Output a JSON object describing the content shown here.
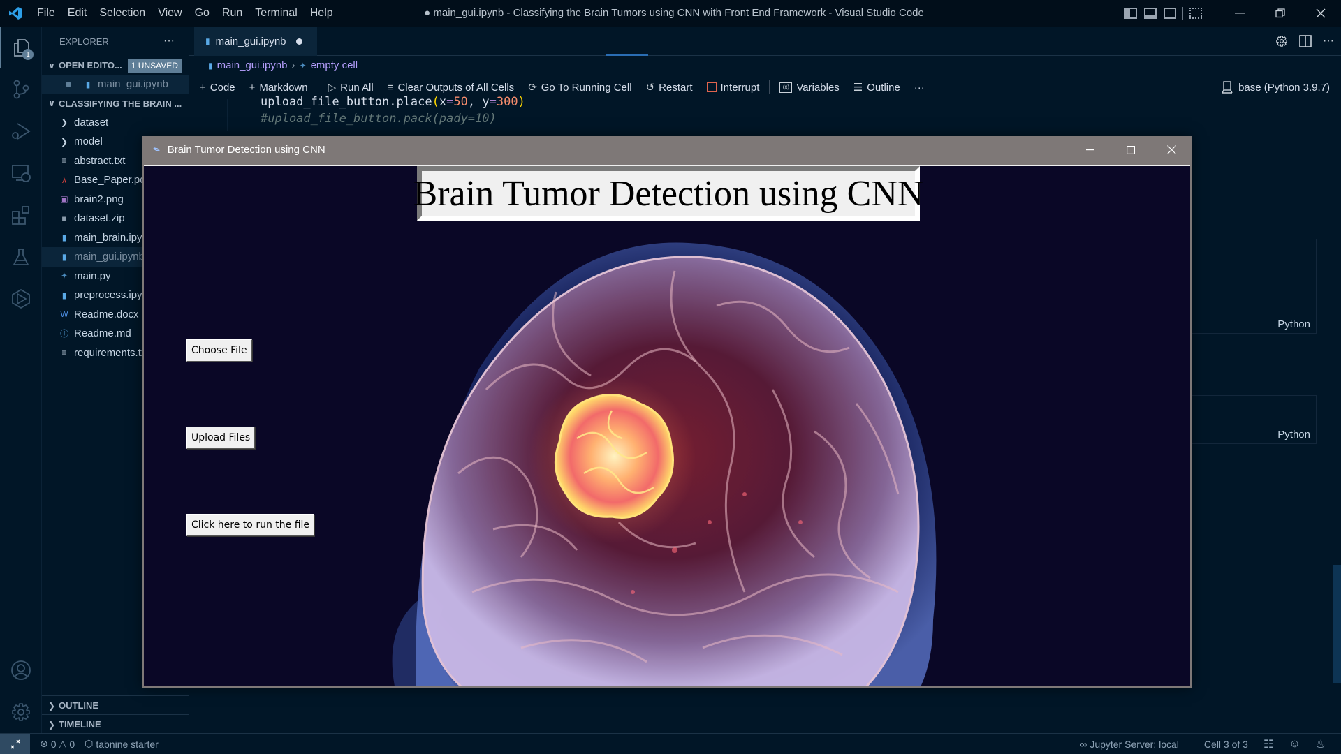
{
  "window": {
    "title": "● main_gui.ipynb - Classifying the Brain Tumors using CNN with Front End Framework - Visual Studio Code",
    "menu": [
      "File",
      "Edit",
      "Selection",
      "View",
      "Go",
      "Run",
      "Terminal",
      "Help"
    ]
  },
  "activity_bar": {
    "items": [
      {
        "name": "explorer",
        "badge": "1"
      },
      {
        "name": "source-control"
      },
      {
        "name": "run-debug"
      },
      {
        "name": "remote-explorer"
      },
      {
        "name": "extensions"
      },
      {
        "name": "testing"
      },
      {
        "name": "jupyter"
      }
    ],
    "bottom": [
      {
        "name": "accounts"
      },
      {
        "name": "manage"
      }
    ]
  },
  "sidebar": {
    "header": "EXPLORER",
    "more": "···",
    "open_editors": {
      "label": "OPEN EDITO...",
      "badge": "1 UNSAVED",
      "items": [
        "main_gui.ipynb"
      ]
    },
    "project": {
      "label": "CLASSIFYING THE BRAIN ...",
      "items": [
        {
          "label": "dataset",
          "type": "folder"
        },
        {
          "label": "model",
          "type": "folder"
        },
        {
          "label": "abstract.txt",
          "type": "text"
        },
        {
          "label": "Base_Paper.pdf",
          "type": "pdf"
        },
        {
          "label": "brain2.png",
          "type": "image"
        },
        {
          "label": "dataset.zip",
          "type": "zip"
        },
        {
          "label": "main_brain.ipynb",
          "type": "notebook"
        },
        {
          "label": "main_gui.ipynb",
          "type": "notebook",
          "selected": true
        },
        {
          "label": "main.py",
          "type": "python"
        },
        {
          "label": "preprocess.ipynb",
          "type": "notebook"
        },
        {
          "label": "Readme.docx",
          "type": "word"
        },
        {
          "label": "Readme.md",
          "type": "info"
        },
        {
          "label": "requirements.txt",
          "type": "text"
        }
      ]
    },
    "outline": "OUTLINE",
    "timeline": "TIMELINE"
  },
  "editor": {
    "tab": {
      "label": "main_gui.ipynb",
      "dirty": true
    },
    "breadcrumb": [
      "main_gui.ipynb",
      "empty cell"
    ],
    "toolbar": {
      "code": "Code",
      "markdown": "Markdown",
      "run_all": "Run All",
      "clear_outputs": "Clear Outputs of All Cells",
      "go_to_running": "Go To Running Cell",
      "restart": "Restart",
      "interrupt": "Interrupt",
      "variables": "Variables",
      "outline": "Outline",
      "more": "···",
      "kernel": "base (Python 3.9.7)"
    },
    "code_lines": {
      "line1": {
        "ident": "upload_file_button.place",
        "open": "(",
        "x": "x",
        "eq": "=",
        "xval": "50",
        "comma": ", ",
        "y": "y",
        "yval": "300",
        "close": ")"
      },
      "line2": "#upload_file_button.pack(pady=10)"
    },
    "cell_languages": [
      "Python",
      "Python"
    ]
  },
  "tk_app": {
    "title": "Brain Tumor Detection using CNN",
    "heading": "Brain Tumor Detection using CNN",
    "buttons": [
      "Choose File",
      "Upload Files",
      "Click here to run the file"
    ],
    "image_description": "3D rendered translucent brain with glowing tumor"
  },
  "statusbar": {
    "errors": "0",
    "warnings": "0",
    "tabnine": "tabnine starter",
    "jupyter_server": "Jupyter Server: local",
    "cell_position": "Cell 3 of 3"
  },
  "colors": {
    "background": "#011627",
    "accent": "#5f7e97",
    "tk_titlebar": "#7e7877",
    "tk_background": "#0a0726"
  }
}
